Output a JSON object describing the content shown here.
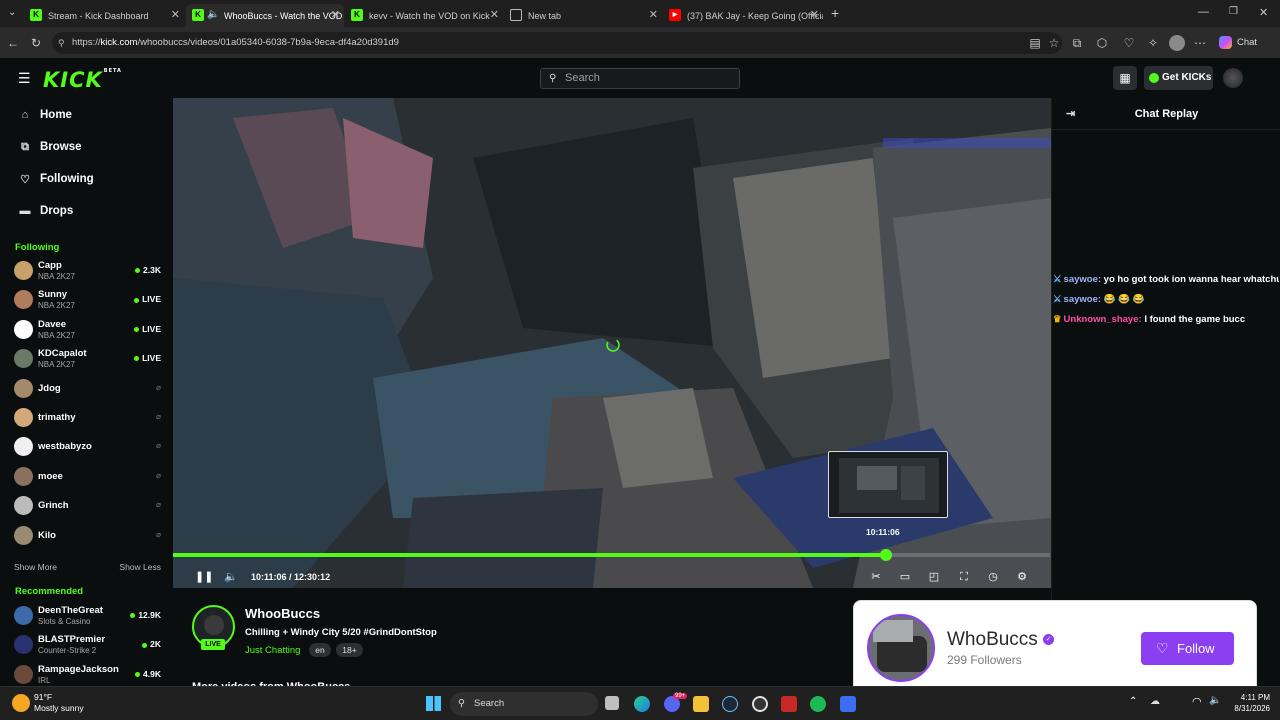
{
  "browser": {
    "tabs": [
      {
        "title": "Stream - Kick Dashboard",
        "active": false
      },
      {
        "title": "WhooBuccs - Watch the VOD",
        "active": true
      },
      {
        "title": "kevv - Watch the VOD on Kick",
        "active": false
      },
      {
        "title": "New tab",
        "active": false
      },
      {
        "title": "(37) BAK Jay - Keep Going (Official",
        "active": false
      }
    ],
    "url_prefix": "https://",
    "url_host": "kick.com",
    "url_path": "/whoobuccs/videos/01a05340-6038-7b9a-9eca-df4a20d391d9",
    "copilot_label": "Chat"
  },
  "header": {
    "logo": "KICK",
    "logo_badge": "BETA",
    "search_placeholder": "Search",
    "get_kicks": "Get KICKs"
  },
  "sidebar": {
    "nav": [
      {
        "label": "Home",
        "icon": "home-icon"
      },
      {
        "label": "Browse",
        "icon": "browse-icon"
      },
      {
        "label": "Following",
        "icon": "heart-icon"
      },
      {
        "label": "Drops",
        "icon": "drops-icon"
      }
    ],
    "following_title": "Following",
    "following": [
      {
        "name": "Capp",
        "category": "NBA 2K27",
        "status": "2.3K",
        "color": "#c7a06a"
      },
      {
        "name": "Sunny",
        "category": "NBA 2K27",
        "status": "LIVE",
        "color": "#b07c5c"
      },
      {
        "name": "Davee",
        "category": "NBA 2K27",
        "status": "LIVE",
        "color": "#ffffff"
      },
      {
        "name": "KDCapalot",
        "category": "NBA 2K27",
        "status": "LIVE",
        "color": "#6a7a66"
      },
      {
        "name": "Jdog",
        "category": "",
        "status": "",
        "color": "#a48a6a"
      },
      {
        "name": "trimathy",
        "category": "",
        "status": "",
        "color": "#d4a87a"
      },
      {
        "name": "westbabyzo",
        "category": "",
        "status": "",
        "color": "#f0f0f0"
      },
      {
        "name": "moee",
        "category": "",
        "status": "",
        "color": "#8a7060"
      },
      {
        "name": "Grinch",
        "category": "",
        "status": "",
        "color": "#bbbbbb"
      },
      {
        "name": "Kilo",
        "category": "",
        "status": "",
        "color": "#9a8a70"
      }
    ],
    "show_more": "Show More",
    "show_less": "Show Less",
    "recommended_title": "Recommended",
    "recommended": [
      {
        "name": "DeenTheGreat",
        "category": "Slots & Casino",
        "status": "12.9K",
        "color": "#3d6aa8"
      },
      {
        "name": "BLASTPremier",
        "category": "Counter-Strike 2",
        "status": "2K",
        "color": "#2a3170"
      },
      {
        "name": "RampageJackson",
        "category": "IRL",
        "status": "4.9K",
        "color": "#6a4a3a"
      }
    ]
  },
  "player": {
    "current_time": "10:11:06",
    "duration": "12:30:12",
    "progress": 0.813,
    "preview_time": "10:11:06"
  },
  "chat": {
    "title": "Chat Replay",
    "messages": [
      {
        "user": "saywoe:",
        "text": "yo ho got took ion wanna hear whatchu gotta sah",
        "color": "#9db4ff",
        "badge": "sword-badge-icon"
      },
      {
        "user": "saywoe:",
        "text": "😂 😂 😂",
        "color": "#9db4ff",
        "badge": "sword-badge-icon"
      },
      {
        "user": "Unknown_shaye:",
        "text": "I found the game bucc",
        "color": "#ff4fa3",
        "badge": "crown-badge-icon"
      }
    ]
  },
  "channel": {
    "name": "WhooBuccs",
    "title": "Chilling + Windy City 5/20 #GrindDontStop",
    "category": "Just Chatting",
    "tags": [
      "en",
      "18+"
    ],
    "live_badge": "LIVE",
    "more_videos": "More videos from WhooBuccs"
  },
  "follow_card": {
    "name": "WhoBuccs",
    "followers": "299 Followers",
    "button": "Follow"
  },
  "taskbar": {
    "weather_temp": "91°F",
    "weather_desc": "Mostly sunny",
    "search": "Search",
    "time": "4:11 PM",
    "date": "8/31/2026",
    "notif_count": "99+"
  }
}
